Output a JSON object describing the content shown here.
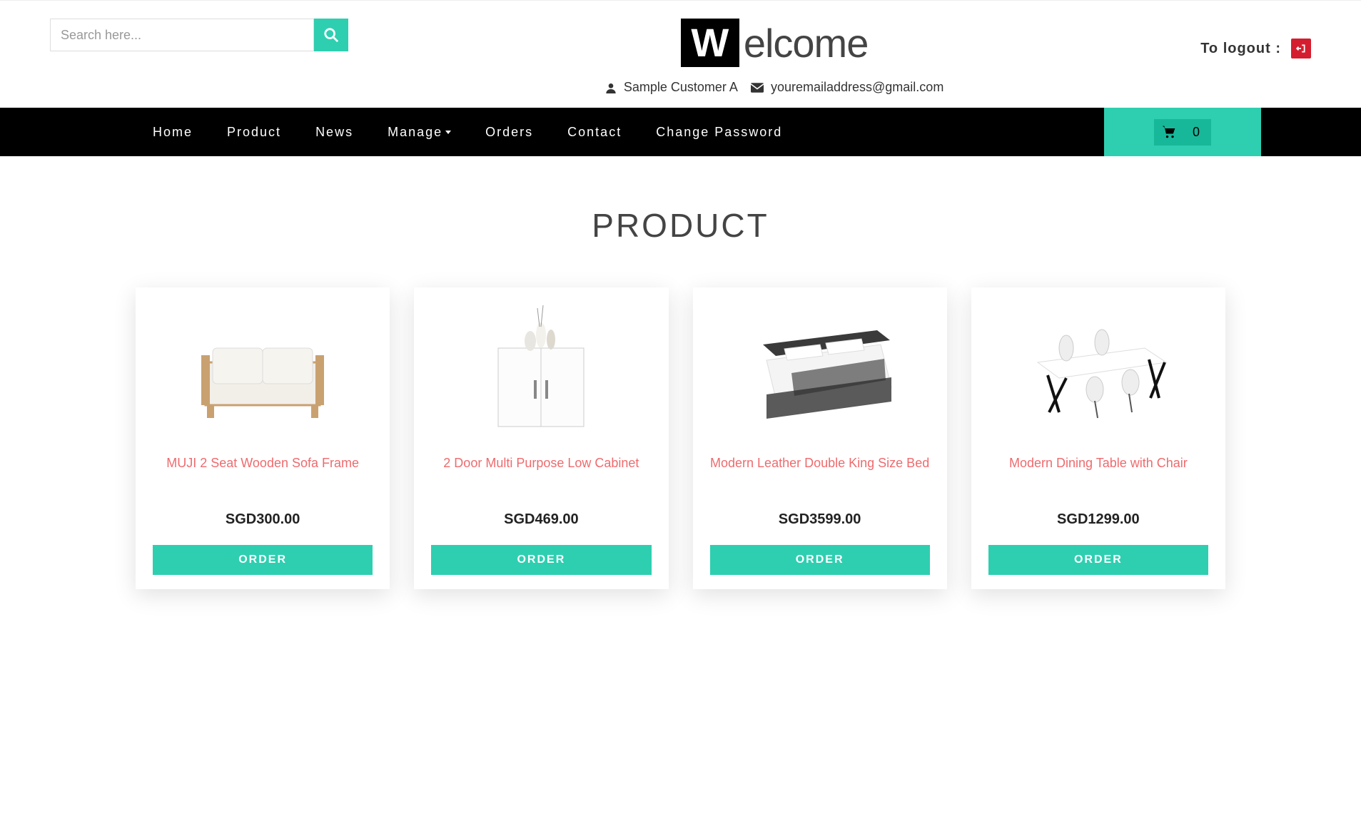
{
  "search": {
    "placeholder": "Search here..."
  },
  "brand": {
    "box": "W",
    "rest": "elcome"
  },
  "user": {
    "name": "Sample Customer A",
    "email": "youremailaddress@gmail.com"
  },
  "logout": {
    "label": "To logout :"
  },
  "nav": {
    "items": [
      "Home",
      "Product",
      "News",
      "Manage",
      "Orders",
      "Contact",
      "Change Password"
    ],
    "cart_count": "0"
  },
  "page_title": "PRODUCT",
  "products": [
    {
      "title": "MUJI 2 Seat Wooden Sofa Frame",
      "price": "SGD300.00",
      "order": "ORDER"
    },
    {
      "title": "2 Door Multi Purpose Low Cabinet",
      "price": "SGD469.00",
      "order": "ORDER"
    },
    {
      "title": "Modern Leather Double King Size Bed",
      "price": "SGD3599.00",
      "order": "ORDER"
    },
    {
      "title": "Modern Dining Table with Chair",
      "price": "SGD1299.00",
      "order": "ORDER"
    }
  ]
}
